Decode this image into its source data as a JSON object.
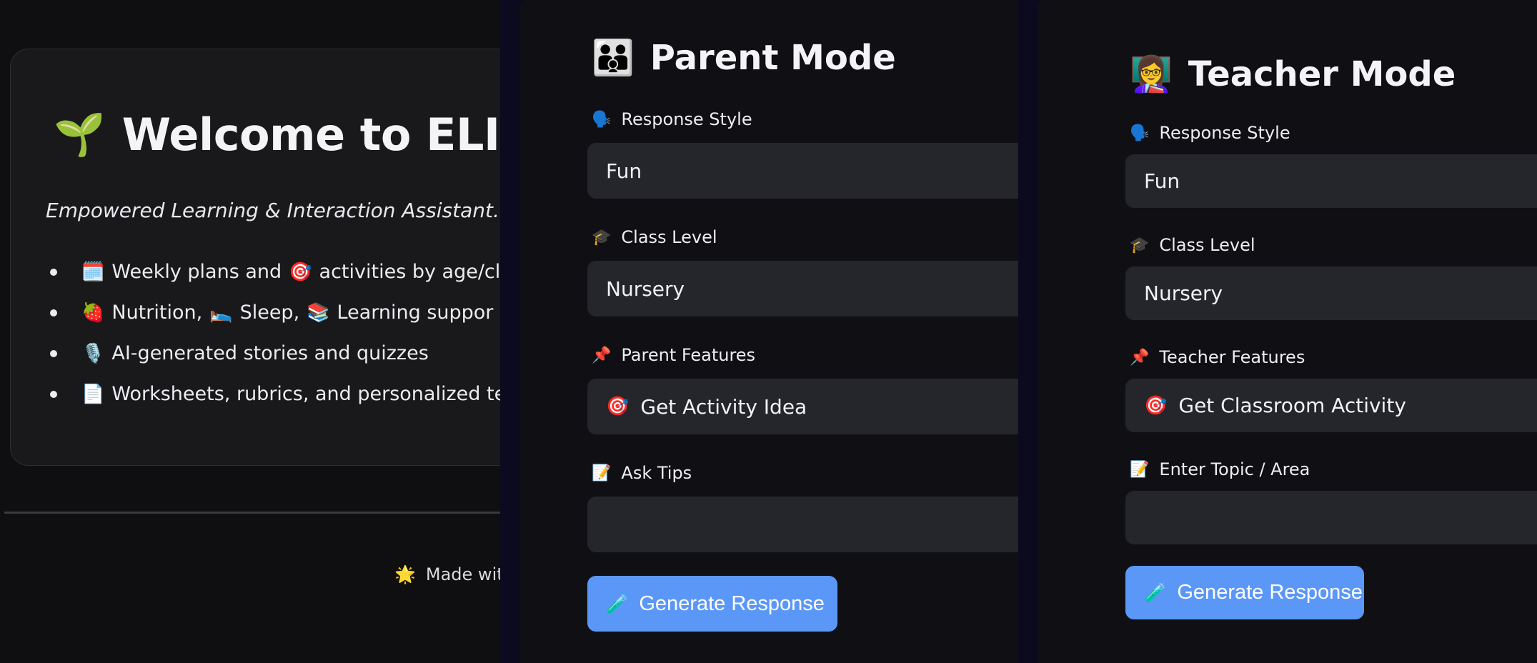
{
  "welcome": {
    "title_icon": "🌱",
    "title": "Welcome to ELIA!",
    "subtitle": "Empowered Learning & Interaction Assistant.",
    "bullets": [
      {
        "icon1": "🗓️",
        "text1": "Weekly plans and",
        "icon2": "🎯",
        "text2": "activities by age/cla"
      },
      {
        "icon1": "🍓",
        "text1": "Nutrition,",
        "icon2": "🛌",
        "text2": "Sleep,",
        "icon3": "📚",
        "text3": "Learning suppor"
      },
      {
        "icon1": "🎙️",
        "text1": "AI-generated stories and quizzes"
      },
      {
        "icon1": "📄",
        "text1": "Worksheets, rubrics, and personalized tea"
      }
    ],
    "footer_icon": "🌟",
    "footer": "Made with"
  },
  "parent": {
    "title_icon": "👪",
    "title": "Parent Mode",
    "style_icon": "🗣️",
    "style_label": "Response Style",
    "style_value": "Fun",
    "class_icon": "🎓",
    "class_label": "Class Level",
    "class_value": "Nursery",
    "features_icon": "📌",
    "features_label": "Parent Features",
    "features_value_icon": "🎯",
    "features_value": "Get Activity Idea",
    "tips_icon": "📝",
    "tips_label": "Ask Tips",
    "tips_value": "",
    "button_icon": "🧪",
    "button_label": "Generate Response"
  },
  "teacher": {
    "title_icon": "👩‍🏫",
    "title": "Teacher Mode",
    "style_icon": "🗣️",
    "style_label": "Response Style",
    "style_value": "Fun",
    "class_icon": "🎓",
    "class_label": "Class Level",
    "class_value": "Nursery",
    "features_icon": "📌",
    "features_label": "Teacher Features",
    "features_value_icon": "🎯",
    "features_value": "Get Classroom Activity",
    "topic_icon": "📝",
    "topic_label": "Enter Topic / Area",
    "topic_value": "",
    "button_icon": "🧪",
    "button_label": "Generate Response"
  }
}
